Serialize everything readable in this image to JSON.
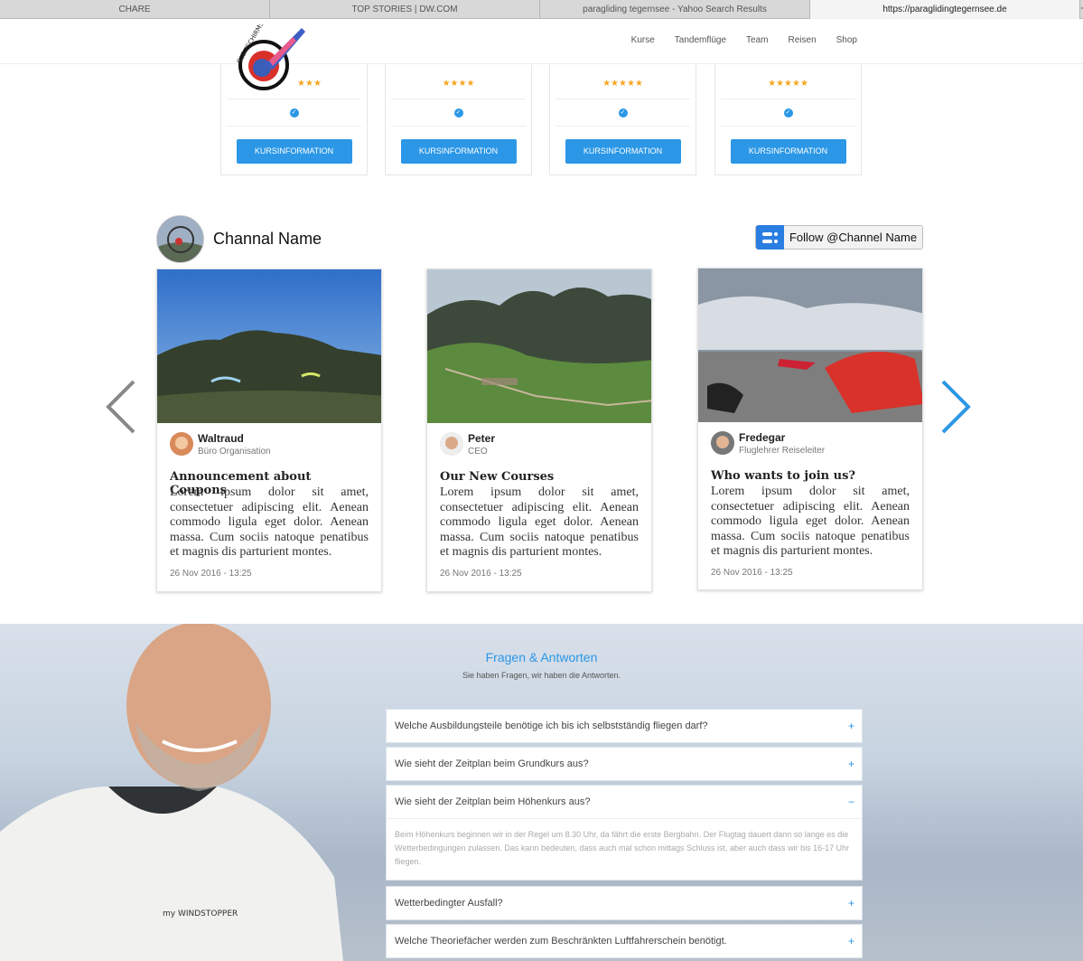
{
  "browser": {
    "tabs": [
      "CHARE",
      "TOP STORIES | DW.COM",
      "paragliding tegernsee - Yahoo Search Results",
      "https://paraglidingtegernsee.de"
    ],
    "new_tab": "+"
  },
  "header": {
    "nav": [
      "Kurse",
      "Tandemflüge",
      "Team",
      "Reisen",
      "Shop"
    ]
  },
  "courses": [
    {
      "stars": "★★★",
      "button": "KURSINFORMATION"
    },
    {
      "stars": "★★★★",
      "button": "KURSINFORMATION"
    },
    {
      "stars": "★★★★★",
      "button": "KURSINFORMATION"
    },
    {
      "stars": "★★★★★",
      "button": "KURSINFORMATION"
    }
  ],
  "channel": {
    "name": "Channal Name",
    "follow_label": "Follow @Channel Name"
  },
  "posts": [
    {
      "author": "Waltraud",
      "role": "Büro Organisation",
      "title": "Announcement about Coupons",
      "body": "Lorem ipsum dolor sit amet, consectetuer adipiscing elit. Aenean commodo ligula eget dolor. Aenean massa. Cum sociis natoque penatibus et magnis dis parturient montes.",
      "date": "26 Nov 2016 - 13:25"
    },
    {
      "author": "Peter",
      "role": "CEO",
      "title": "Our New Courses",
      "body": "Lorem ipsum dolor sit amet, consectetuer adipiscing elit. Aenean commodo ligula eget dolor. Aenean massa. Cum sociis natoque penatibus et magnis dis parturient montes.",
      "date": "26 Nov 2016 - 13:25"
    },
    {
      "author": "Fredegar",
      "role": "Fluglehrer Reiseleiter",
      "title": "Who wants to join us?",
      "body": "Lorem ipsum dolor sit amet, consectetuer adipiscing elit. Aenean commodo ligula eget dolor. Aenean massa. Cum sociis natoque penatibus et magnis dis parturient montes.",
      "date": "26 Nov 2016 - 13:25"
    }
  ],
  "faq": {
    "title": "Fragen & Antworten",
    "subtitle": "Sie haben Fragen, wir haben die Antworten.",
    "items": [
      {
        "q": "Welche Ausbildungsteile benötige ich bis ich selbstständig fliegen darf?",
        "toggle": "+"
      },
      {
        "q": "Wie sieht der Zeitplan beim Grundkurs aus?",
        "toggle": "+"
      },
      {
        "q": "Wie sieht der Zeitplan beim Höhenkurs aus?",
        "toggle": "−",
        "a": "Beim Höhenkurs beginnen wir in der Regel um 8.30 Uhr, da fährt die erste Bergbahn. Der Flugtag dauert dann so lange es die Wetterbedingungen zulassen. Das kann bedeuten, dass auch mal schon mittags Schluss ist, aber auch dass wir bis 16-17 Uhr fliegen."
      },
      {
        "q": "Wetterbedingter Ausfall?",
        "toggle": "+"
      },
      {
        "q": "Welche Theoriefächer werden zum Beschränkten Luftfahrerschein benötigt.",
        "toggle": "+"
      }
    ]
  },
  "colors": {
    "accent": "#2b97e6",
    "follow": "#2a7de1",
    "stars": "#f5a623"
  }
}
